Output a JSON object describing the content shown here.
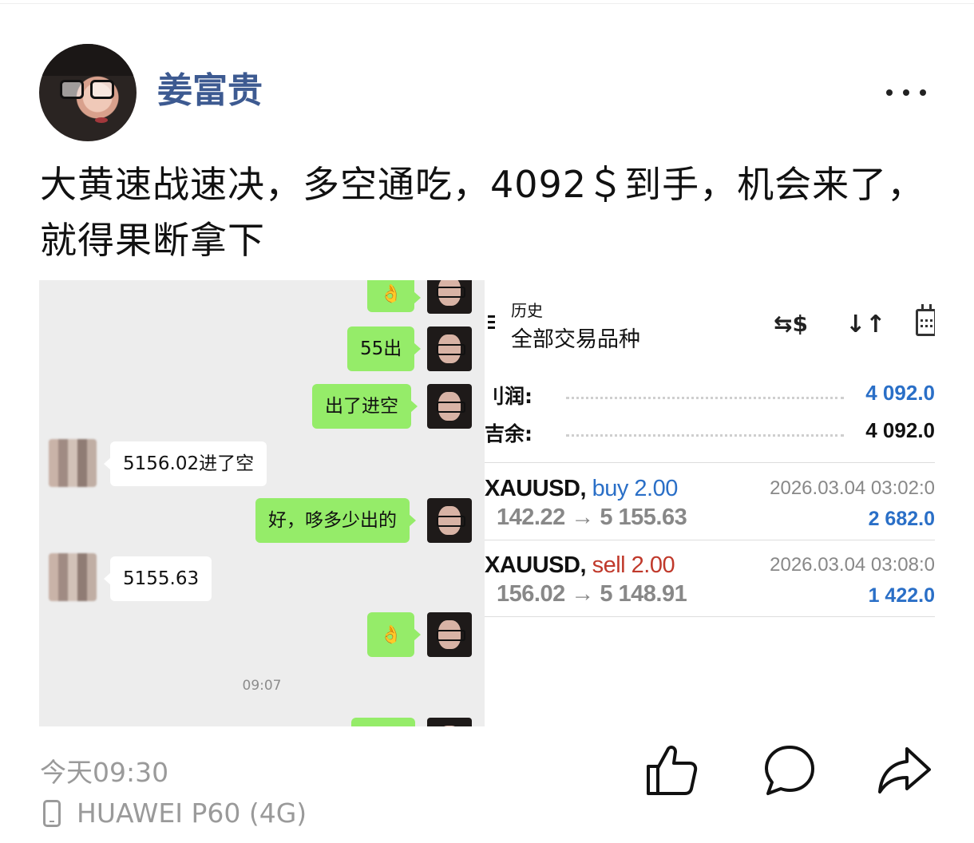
{
  "post": {
    "username": "姜富贵",
    "text": "大黄速战速决，多空通吃，4092＄到手，机会来了，就得果断拿下",
    "time": "今天09:30",
    "device": "HUAWEI P60 (4G)"
  },
  "chat": {
    "messages": [
      {
        "side": "right",
        "text": "👌"
      },
      {
        "side": "right",
        "text": "55出"
      },
      {
        "side": "right",
        "text": "出了进空"
      },
      {
        "side": "left",
        "text": "5156.02进了空"
      },
      {
        "side": "right",
        "text": "好，哆多少出的"
      },
      {
        "side": "left",
        "text": "5155.63"
      },
      {
        "side": "right",
        "text": "👌"
      }
    ],
    "timestamp": "09:07"
  },
  "trade": {
    "title": "历史",
    "subtitle": "全部交易品种",
    "profit_label": "刂润:",
    "profit_value": "4 092.0",
    "balance_label": "吉余:",
    "balance_value": "4 092.0",
    "deals": [
      {
        "symbol": "XAUUSD,",
        "direction": "buy",
        "volume": "2.00",
        "prices": "142.22 → 5 155.63",
        "datetime": "2026.03.04 03:02:0",
        "pnl": "2 682.0"
      },
      {
        "symbol": "XAUUSD,",
        "direction": "sell",
        "volume": "2.00",
        "prices": "156.02 → 5 148.91",
        "datetime": "2026.03.04 03:08:0",
        "pnl": "1 422.0"
      }
    ],
    "colors": {
      "buy": "#2a6fc7",
      "sell": "#c0392b",
      "profit": "#2a6fc7"
    }
  }
}
